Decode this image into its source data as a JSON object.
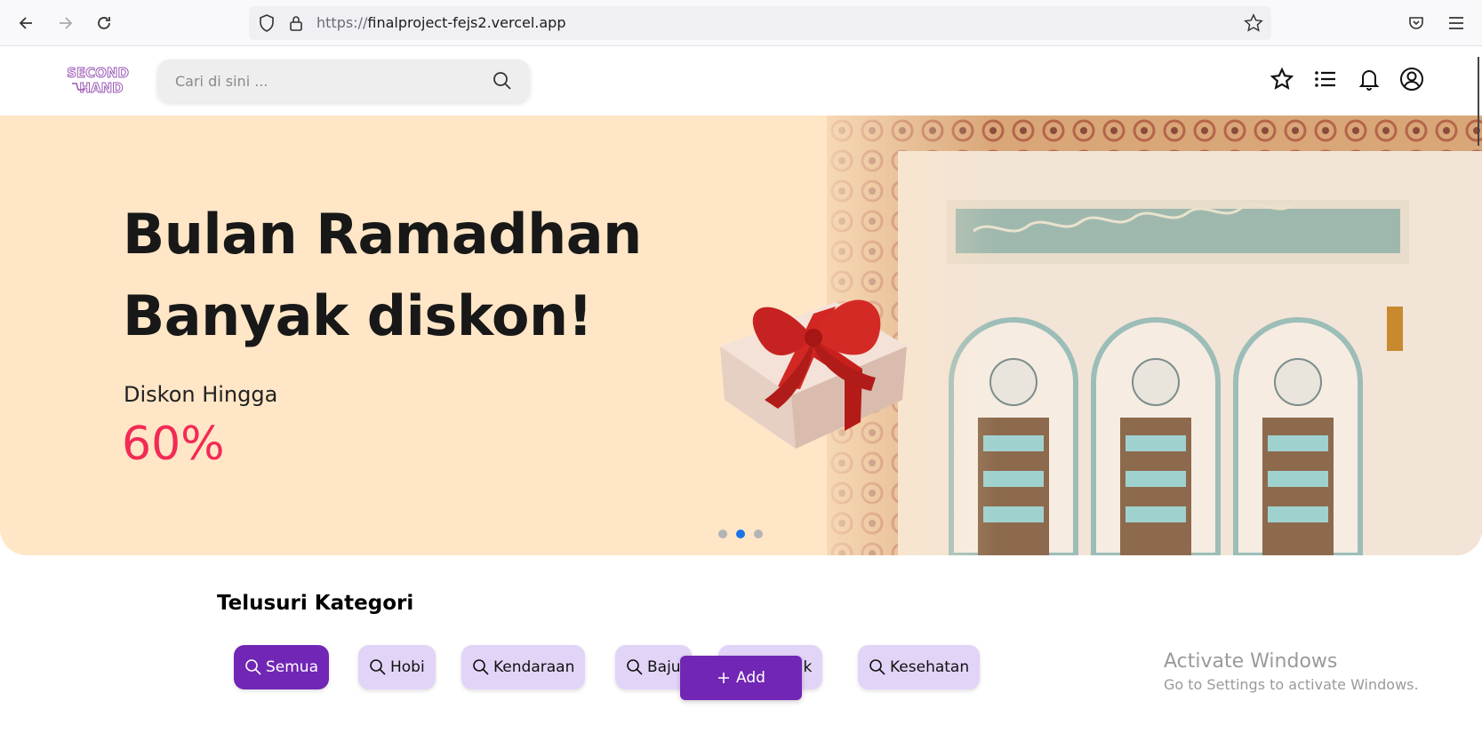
{
  "browser": {
    "url_protocol": "https://",
    "url_host": "finalproject-fejs2.vercel.app"
  },
  "header": {
    "logo_line1": "SECOND",
    "logo_line2": "HAND",
    "search_placeholder": "Cari di sini ..."
  },
  "hero": {
    "title_line1": "Bulan Ramadhan",
    "title_line2": "Banyak diskon!",
    "subtitle": "Diskon Hingga",
    "discount": "60%",
    "slides": 3,
    "active_slide": 2
  },
  "categories": {
    "title": "Telusuri Kategori",
    "items": [
      {
        "label": "Semua",
        "active": true
      },
      {
        "label": "Hobi",
        "active": false
      },
      {
        "label": "Kendaraan",
        "active": false
      },
      {
        "label": "Baju",
        "active": false
      },
      {
        "label": "nik",
        "active": false
      },
      {
        "label": "Kesehatan",
        "active": false
      }
    ]
  },
  "add_button": {
    "label": "Add"
  },
  "watermark": {
    "line1": "Activate Windows",
    "line2": "Go to Settings to activate Windows."
  },
  "colors": {
    "brand_purple": "#7126b5",
    "chip_bg": "#e2d4f7",
    "hero_bg": "#ffe6c6",
    "discount_red": "#f22a55"
  }
}
